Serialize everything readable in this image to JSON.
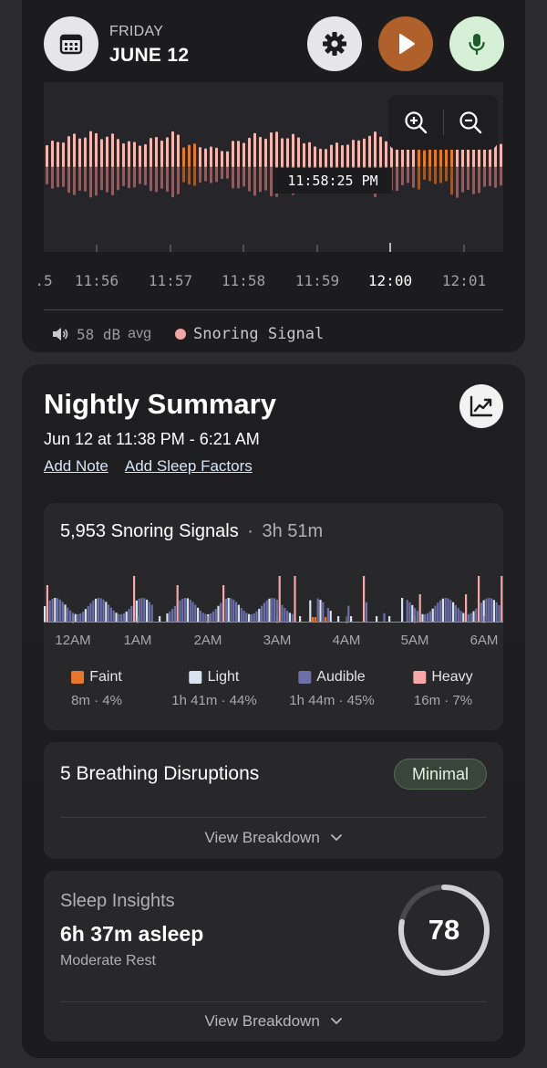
{
  "header": {
    "day": "FRIDAY",
    "date": "JUNE 12",
    "icons": {
      "calendar": "calendar-icon",
      "settings": "gear-icon",
      "play": "play-icon",
      "mic": "microphone-icon"
    },
    "colors": {
      "play_bg": "#b0602a",
      "mic_bg": "#d5f0d7",
      "settings_bg": "#e5e5ea"
    }
  },
  "waveform": {
    "cursor_time": "11:58:25 PM",
    "ticks": [
      ".5",
      "11:56",
      "11:57",
      "11:58",
      "11:59",
      "12:00",
      "12:01"
    ],
    "active_tick": "12:00",
    "zoom_in_icon": "zoom-in-icon",
    "zoom_out_icon": "zoom-out-icon",
    "colors": {
      "upper": "#f4b7b0",
      "lower": "#8b5e5f",
      "highlight": "#e17a2b"
    }
  },
  "legend": {
    "volume": "58 dB",
    "volume_suffix": "avg",
    "signal": "Snoring Signal"
  },
  "summary": {
    "title": "Nightly Summary",
    "range": "Jun 12 at 11:38 PM - 6:21 AM",
    "add_note": "Add Note",
    "add_factors": "Add Sleep Factors",
    "trend_icon": "trend-chart-icon"
  },
  "snoring": {
    "count": "5,953 Snoring Signals",
    "separator": "·",
    "duration": "3h 51m",
    "hours": [
      "12AM",
      "1AM",
      "2AM",
      "3AM",
      "4AM",
      "5AM",
      "6AM"
    ],
    "categories": [
      {
        "name": "Faint",
        "value": "8m · 4%",
        "color": "#e8772e"
      },
      {
        "name": "Light",
        "value": "1h 41m · 44%",
        "color": "#d8e3f2"
      },
      {
        "name": "Audible",
        "value": "1h 44m · 45%",
        "color": "#6c6fa8"
      },
      {
        "name": "Heavy",
        "value": "16m · 7%",
        "color": "#f4a8a8"
      }
    ]
  },
  "breathing": {
    "title": "5 Breathing Disruptions",
    "badge": "Minimal",
    "view": "View Breakdown"
  },
  "insights": {
    "label": "Sleep Insights",
    "asleep": "6h 37m asleep",
    "quality": "Moderate Rest",
    "score": "78",
    "score_max": 100,
    "view": "View Breakdown"
  }
}
